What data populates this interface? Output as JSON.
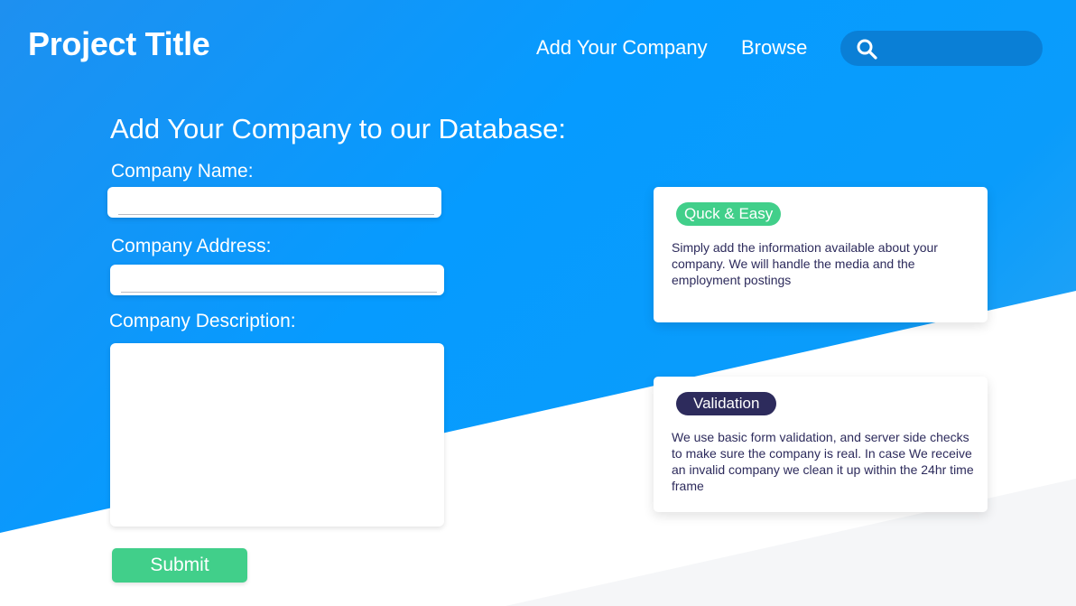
{
  "header": {
    "brand": "Project Title",
    "nav": {
      "add_company": "Add Your Company",
      "browse": "Browse"
    },
    "search": {
      "placeholder": "",
      "icon": "search-icon"
    }
  },
  "form": {
    "heading": "Add Your Company to our Database:",
    "name_label": "Company Name:",
    "name_value": "",
    "address_label": "Company Address:",
    "address_value": "",
    "description_label": "Company Description:",
    "description_value": "",
    "submit_label": "Submit"
  },
  "cards": [
    {
      "badge": "Quck & Easy",
      "text": "Simply add the information available about your company. We will handle the media and the employment postings"
    },
    {
      "badge": "Validation",
      "text": "We use basic form validation, and server side checks to make sure the company is real. In case We receive an invalid company we clean it up within the 24hr time frame"
    }
  ],
  "colors": {
    "primary_blue": "#069bff",
    "search_bg": "#0a7fd6",
    "green": "#41cf8a",
    "navy": "#2d2b5c"
  }
}
